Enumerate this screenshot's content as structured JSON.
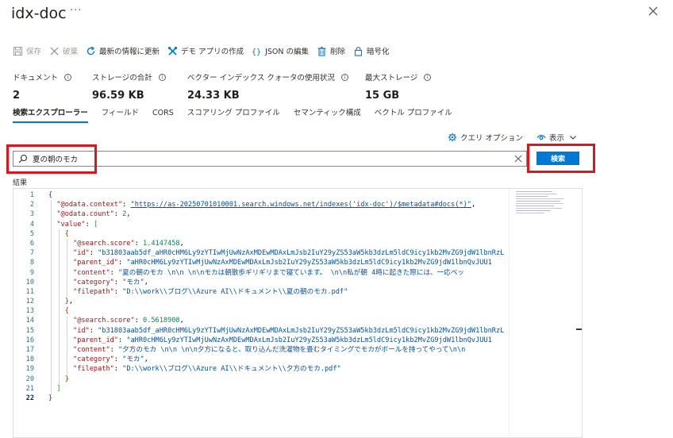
{
  "window": {
    "title": "idx-doc",
    "more": "···"
  },
  "toolbar": {
    "save": "保存",
    "discard": "破棄",
    "refresh": "最新の情報に更新",
    "demo_app": "デモ アプリの作成",
    "edit_json": "JSON の編集",
    "delete": "削除",
    "encrypt": "暗号化"
  },
  "stats": [
    {
      "label": "ドキュメント",
      "value": "2"
    },
    {
      "label": "ストレージの合計",
      "value": "96.59 KB"
    },
    {
      "label": "ベクター インデックス クォータの使用状況",
      "value": "24.33 KB"
    },
    {
      "label": "最大ストレージ",
      "value": "15 GB"
    }
  ],
  "tabs": [
    "検索エクスプローラー",
    "フィールド",
    "CORS",
    "スコアリング プロファイル",
    "セマンティック構成",
    "ベクトル プロファイル"
  ],
  "query_options": "クエリ オプション",
  "view": "表示",
  "search": {
    "value": "夏の朝のモカ",
    "button": "検索"
  },
  "results_label": "結果",
  "code": {
    "line_numbers": [
      "1",
      "2",
      "3",
      "4",
      "5",
      "6",
      "7",
      "8",
      "9",
      "10",
      "11",
      "12",
      "13",
      "14",
      "15",
      "16",
      "17",
      "18",
      "19",
      "20",
      "21",
      "22"
    ],
    "odata_context_key": "\"@odata.context\"",
    "odata_context_value": "\"https://as-20250701010001.search.windows.net/indexes('idx-doc')/$metadata#docs(*)\"",
    "odata_count_key": "\"@odata.count\"",
    "odata_count_value": "2",
    "value_key": "\"value\"",
    "docs": [
      {
        "score": "1.4147458",
        "id": "\"b31803aab5df_aHR0cHM6Ly9zYTIwMjUwNzAxMDEwMDAxLmJsb2IuY29yZS53aW5kb3dzLm5ldC9icy1kb2MvZG9jdW1lbnRzL",
        "parent_id": "\"aHR0cHM6Ly9zYTIwMjUwNzAxMDEwMDAxLmJsb2IuY29yZS53aW5kb3dzLm5ldC9icy1kb2MvZG9jdW1lbnQvJUU1",
        "content": "\"夏の朝のモカ \\n\\n \\n\\nモカは朝散歩ギリギリまで寝ています。 \\n\\n私が朝 4時に起きた際には、一応ベッ",
        "category": "\"モカ\"",
        "filepath": "\"D:\\\\work\\\\ブログ\\\\Azure AI\\\\ドキュメント\\\\夏の朝のモカ.pdf\""
      },
      {
        "score": "0.5618908",
        "id": "\"b31803aab5df_aHR0cHM6Ly9zYTIwMjUwNzAxMDEwMDAxLmJsb2IuY29yZS53aW5kb3dzLm5ldC9icy1kb2MvZG9jdW1lbnRzL",
        "parent_id": "\"aHR0cHM6Ly9zYTIwMjUwNzAxMDEwMDAxLmJsb2IuY29yZS53aW5kb3dzLm5ldC9icy1kb2MvZG9jdW1lbnQvJUU1",
        "content": "\"夕方のモカ \\n\\n \\n\\n夕方になると、取り込んだ洗濯物を畳むタイミングでモカがボールを持ってやって\\n\\n",
        "category": "\"モカ\"",
        "filepath": "\"D:\\\\work\\\\ブログ\\\\Azure AI\\\\ドキュメント\\\\夕方のモカ.pdf\""
      }
    ],
    "keys": {
      "score": "\"@search.score\"",
      "id": "\"id\"",
      "parent_id": "\"parent_id\"",
      "content": "\"content\"",
      "category": "\"category\"",
      "filepath": "\"filepath\""
    }
  },
  "colors": {
    "accent": "#0078d4",
    "highlight_box": "#e0141d"
  }
}
